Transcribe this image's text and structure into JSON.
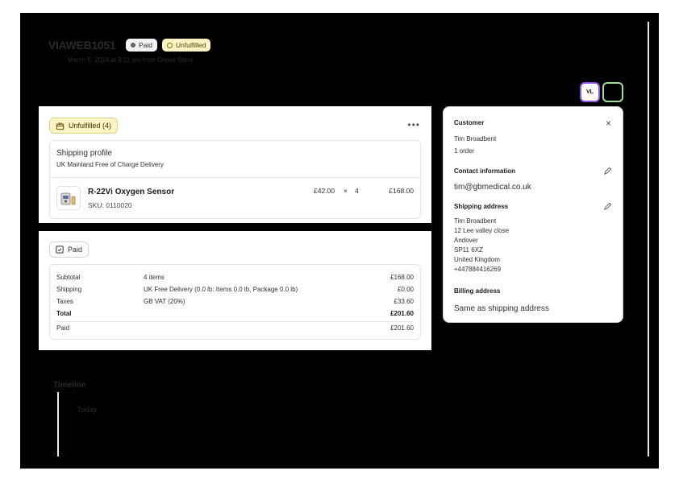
{
  "order": {
    "title": "VIAWEB1051",
    "meta": "March 5, 2024 at 9:11 am from Online Store",
    "badges": {
      "paid": "Paid",
      "unfulfilled": "Unfulfilled"
    }
  },
  "avatars": {
    "vl": "VL"
  },
  "fulfillment": {
    "heading": "Unfulfilled (4)",
    "more": "•••",
    "shipping_profile": "Shipping profile",
    "shipping_profile_name": "UK Mainland Free of Charge Delivery",
    "item": {
      "name": "R-22Vi Oxygen Sensor",
      "sku": "SKU: 0110020",
      "price": "£42.00",
      "times": "×",
      "qty": "4",
      "total": "£168.00"
    }
  },
  "payment": {
    "heading": "Paid",
    "rows": [
      {
        "label": "Subtotal",
        "desc": "4 items",
        "amount": "£168.00"
      },
      {
        "label": "Shipping",
        "desc": "UK Free Delivery (0.0 lb: Items 0.0 lb, Package 0.0 lb)",
        "amount": "£0.00"
      },
      {
        "label": "Taxes",
        "desc": "GB VAT (20%)",
        "amount": "£33.60"
      },
      {
        "label": "Total",
        "desc": "",
        "amount": "£201.60"
      },
      {
        "label": "Paid",
        "desc": "",
        "amount": "£201.60"
      }
    ]
  },
  "customer": {
    "heading": "Customer",
    "close": "×",
    "name": "Tim Broadbent",
    "orders": "1 order",
    "contact_heading": "Contact information",
    "email": "tim@gbmedical.co.uk",
    "shipping_heading": "Shipping address",
    "address": [
      "Tim Broadbent",
      "12 Lee valley close",
      "Andover",
      "SP11 6XZ",
      "United Kingdom",
      "+447884416269"
    ],
    "billing_heading": "Billing address",
    "billing": "Same as shipping address"
  },
  "timeline": {
    "heading": "Timeline",
    "today": "Today"
  },
  "colors": {
    "paid_badge": "#f1f1f1",
    "unfulfilled_badge": "#fdf3c4",
    "avatar_border": "#8a55e0",
    "avatar_green": "#9ee09a"
  },
  "icons": {
    "unfulfilled": "package-icon",
    "paid": "checkbox-icon",
    "edit": "pencil-icon",
    "close": "close-icon"
  }
}
